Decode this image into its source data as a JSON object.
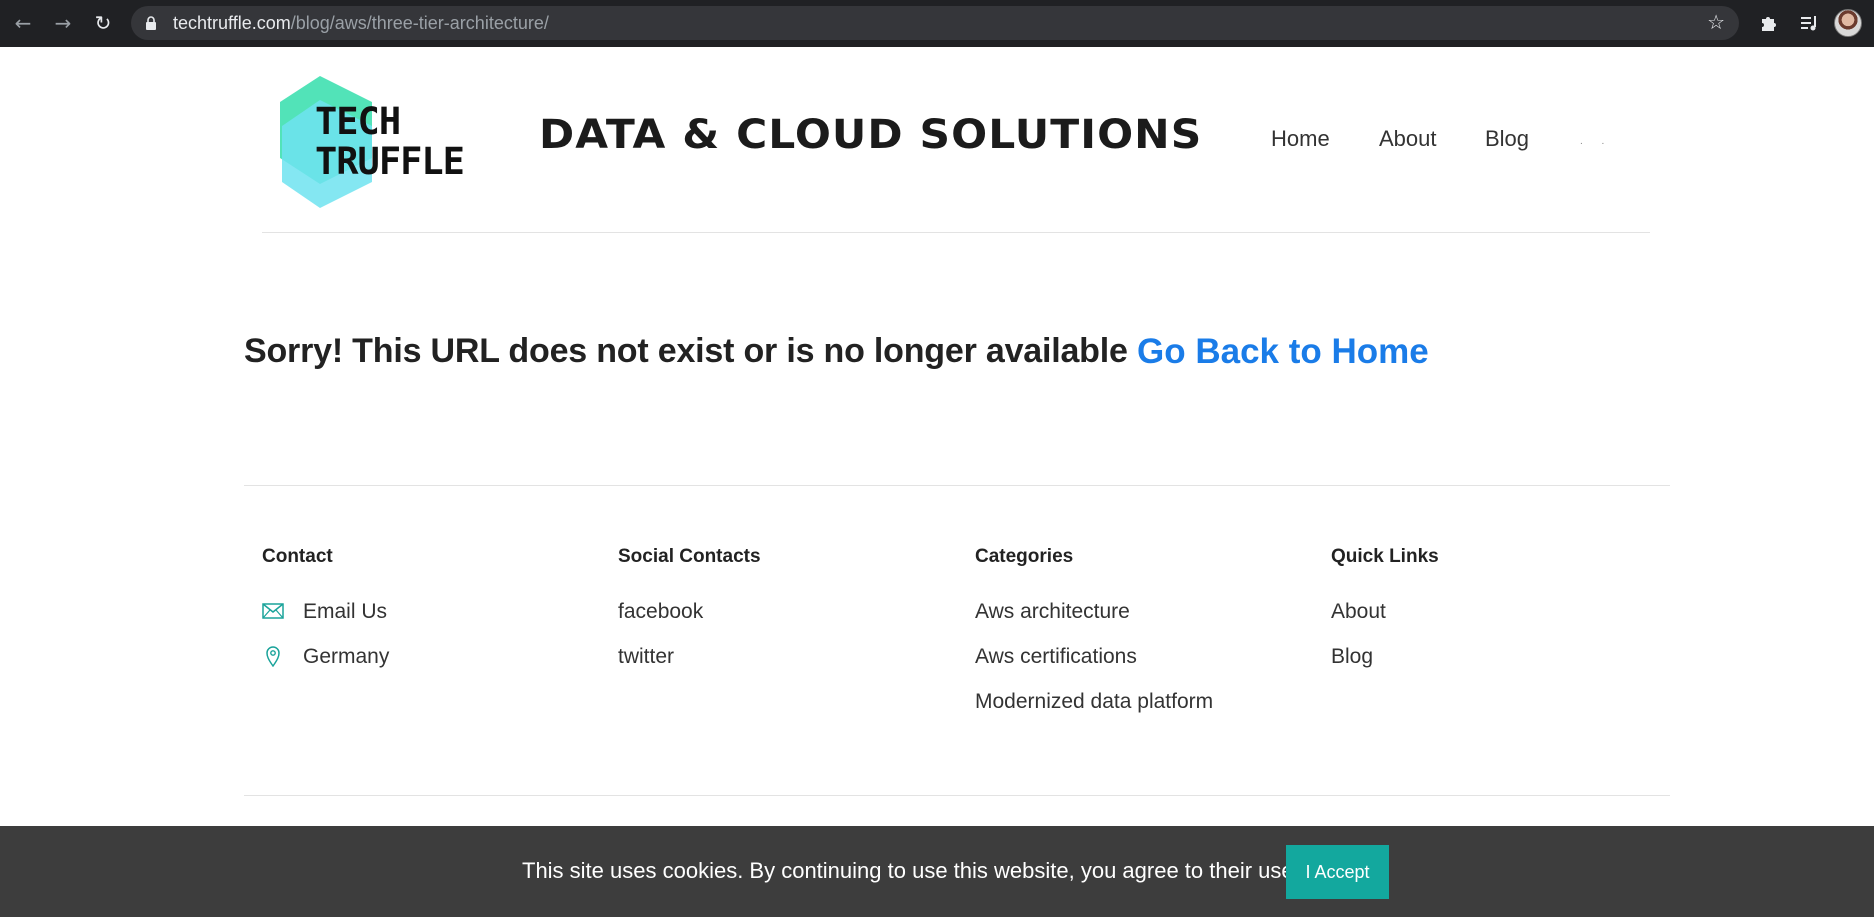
{
  "browser": {
    "url_domain": "techtruffle.com",
    "url_path": "/blog/aws/three-tier-architecture/",
    "back_icon": "arrow-left-icon",
    "forward_icon": "arrow-right-icon",
    "reload_icon": "reload-icon",
    "bookmark_icon": "star-icon",
    "extensions_icon": "puzzle-icon",
    "media_icon": "playlist-icon"
  },
  "header": {
    "logo_line1": "TECH",
    "logo_line2": "TRUFFLE",
    "site_title": "DATA & CLOUD SOLUTIONS",
    "nav": [
      "Home",
      "About",
      "Blog"
    ],
    "nav_more": ". ."
  },
  "main": {
    "error_message": "Sorry! This URL does not exist or is no longer available",
    "home_link": "Go Back to Home"
  },
  "footer": {
    "contact": {
      "heading": "Contact",
      "items": [
        {
          "label": "Email Us",
          "icon": "envelope-icon"
        },
        {
          "label": "Germany",
          "icon": "location-pin-icon"
        }
      ]
    },
    "social": {
      "heading": "Social Contacts",
      "items": [
        "facebook",
        "twitter"
      ]
    },
    "categories": {
      "heading": "Categories",
      "items": [
        "Aws architecture",
        "Aws certifications",
        "Modernized data platform"
      ]
    },
    "quick_links": {
      "heading": "Quick Links",
      "items": [
        "About",
        "Blog"
      ]
    }
  },
  "cookie_bar": {
    "message": "This site uses cookies. By continuing to use this website, you agree to their use.",
    "accept_label": "I Accept"
  },
  "colors": {
    "link_blue": "#1a7ce8",
    "accept_teal": "#13a89e",
    "icon_teal": "#1aa39a",
    "cookie_bg": "#3d3d3d",
    "logo_green": "#3fe0b0",
    "logo_cyan": "#6fe3f0"
  }
}
